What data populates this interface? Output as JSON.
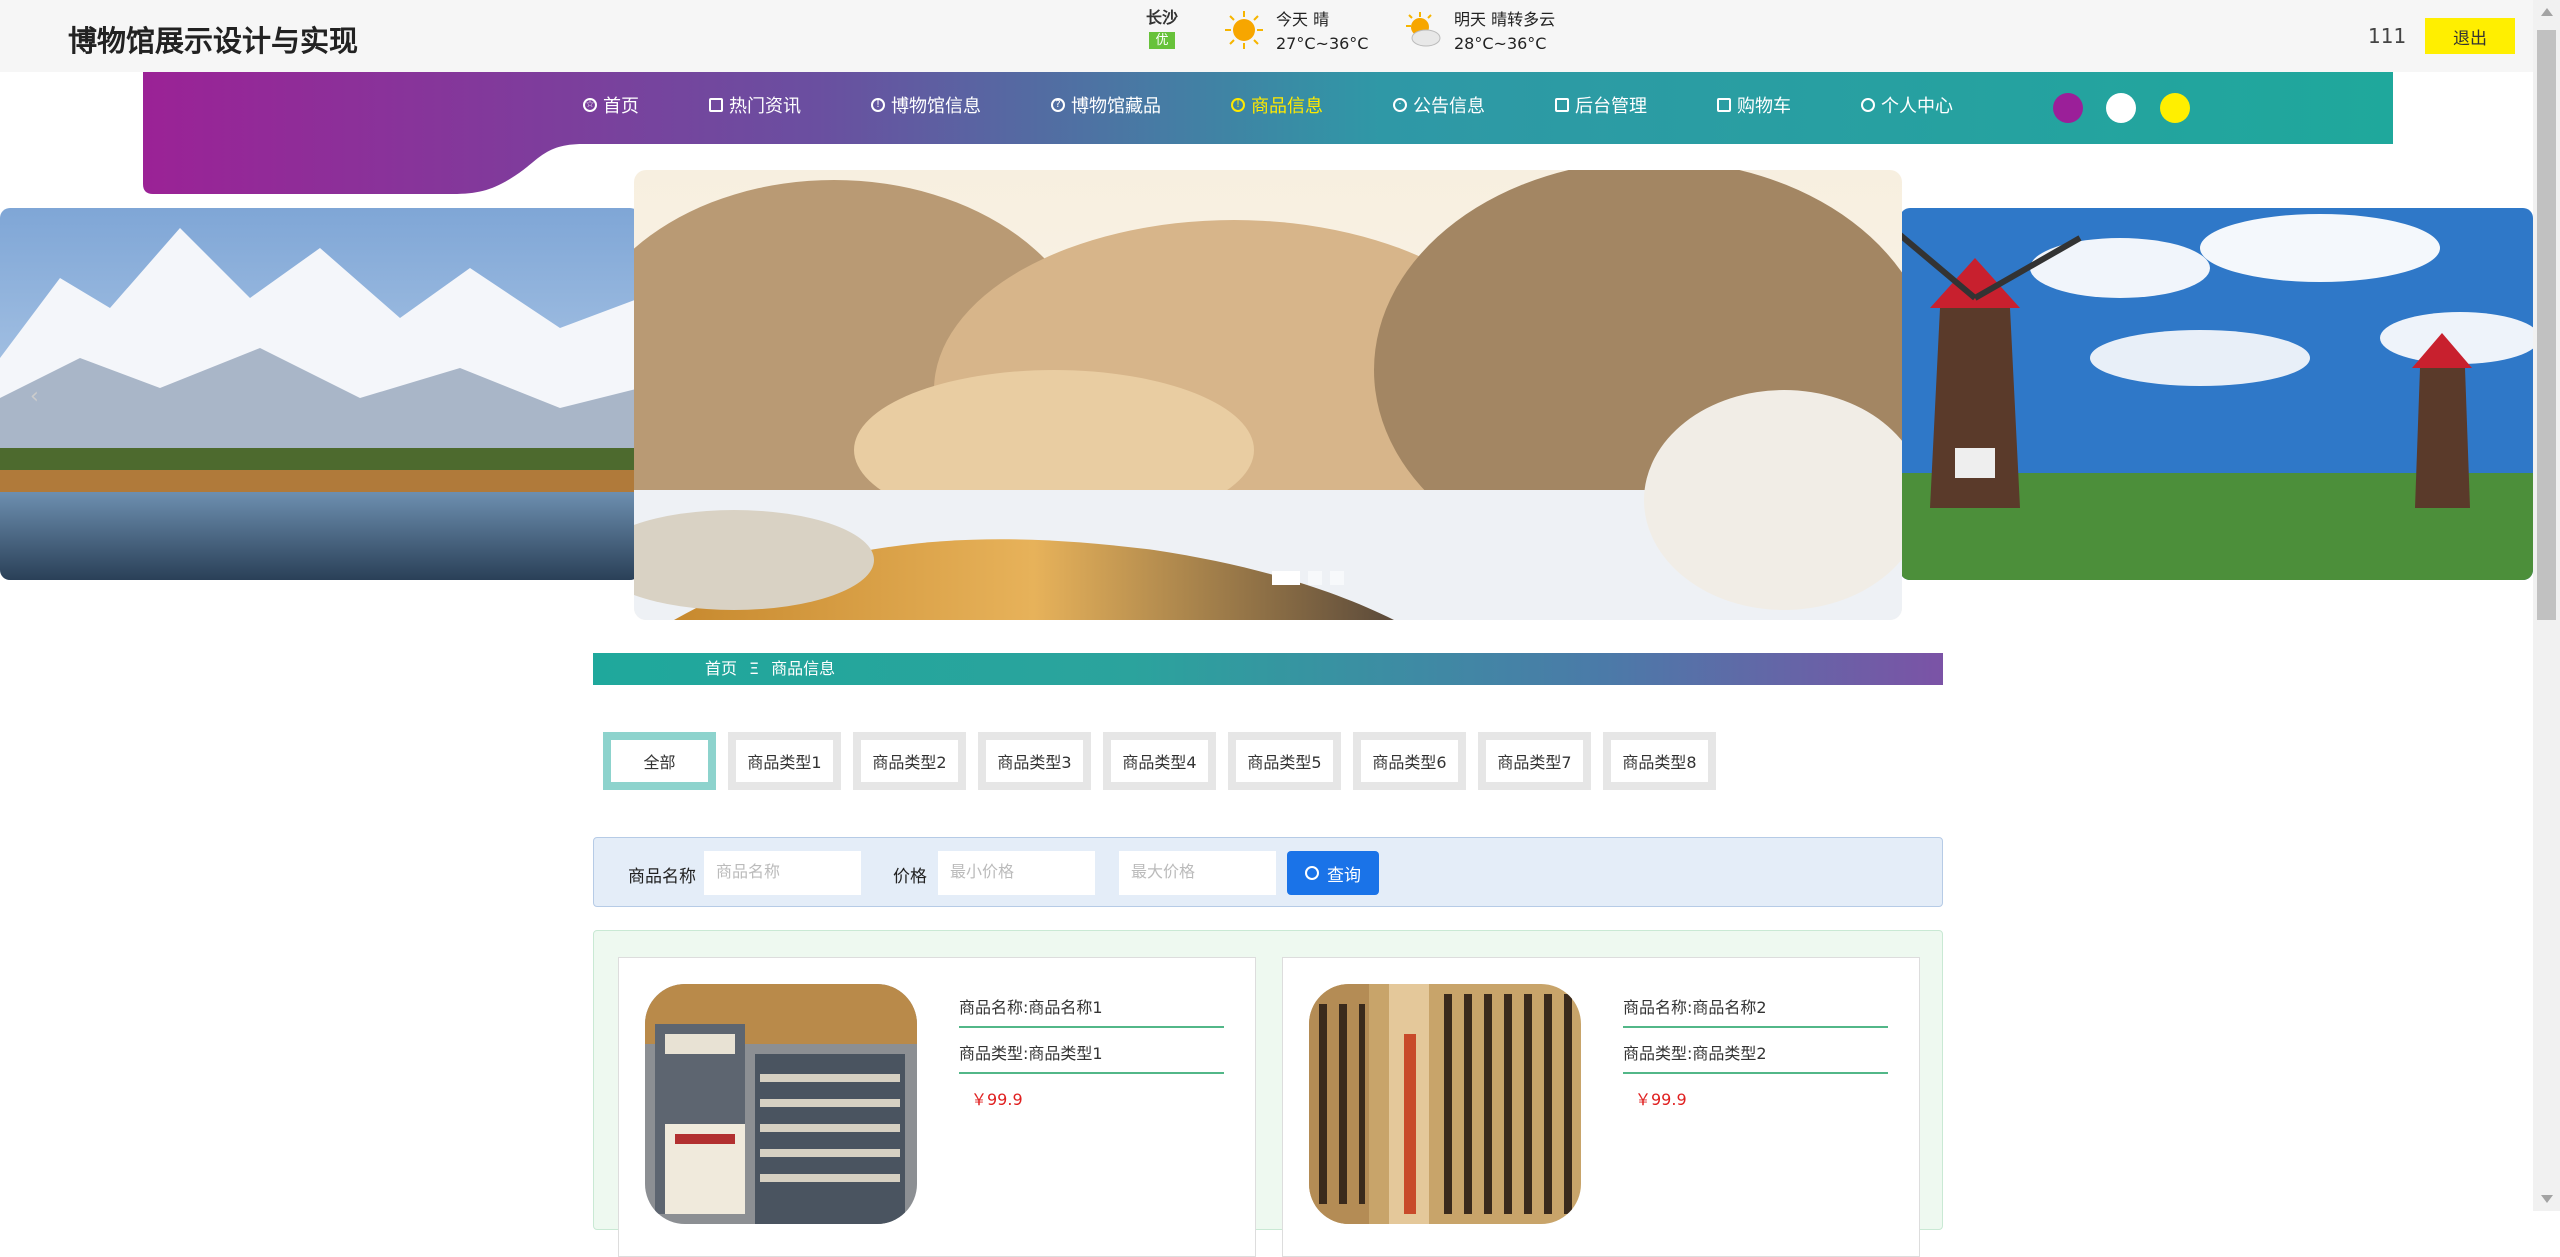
{
  "header": {
    "site_title": "博物馆展示设计与实现",
    "username": "111",
    "logout_label": "退出"
  },
  "weather": {
    "city": "长沙",
    "aqi": "优",
    "today_label": "今天",
    "today_condition": "晴",
    "today_temp": "27°C~36°C",
    "tomorrow_label": "明天",
    "tomorrow_condition": "晴转多云",
    "tomorrow_temp": "28°C~36°C"
  },
  "nav": {
    "items": [
      {
        "label": "首页",
        "icon": "star-icon"
      },
      {
        "label": "热门资讯",
        "icon": "bag-icon"
      },
      {
        "label": "博物馆信息",
        "icon": "info-icon"
      },
      {
        "label": "博物馆藏品",
        "icon": "question-icon"
      },
      {
        "label": "商品信息",
        "icon": "info-icon"
      },
      {
        "label": "公告信息",
        "icon": "gear-icon"
      },
      {
        "label": "后台管理",
        "icon": "gift-icon"
      },
      {
        "label": "购物车",
        "icon": "cart-icon"
      },
      {
        "label": "个人中心",
        "icon": "user-icon"
      }
    ],
    "active_index": 4,
    "theme_colors": [
      "#9b1f99",
      "#ffffff",
      "#ffef00"
    ]
  },
  "colors": {
    "nav_gradient_start": "#9b2296",
    "nav_gradient_mid": "#3a8fa8",
    "nav_gradient_end": "#1fa89c",
    "active_nav": "#ffe900",
    "price": "#e02020",
    "query_button": "#1a73e8"
  },
  "breadcrumb": {
    "home": "首页",
    "separator": "Ξ",
    "current": "商品信息"
  },
  "categories": {
    "items": [
      "全部",
      "商品类型1",
      "商品类型2",
      "商品类型3",
      "商品类型4",
      "商品类型5",
      "商品类型6",
      "商品类型7",
      "商品类型8"
    ],
    "active_index": 0
  },
  "search": {
    "name_label": "商品名称",
    "name_placeholder": "商品名称",
    "price_label": "价格",
    "min_placeholder": "最小价格",
    "max_placeholder": "最大价格",
    "query_label": "查询"
  },
  "products": [
    {
      "name": "商品名称:商品名称1",
      "type": "商品类型:商品类型1",
      "price": "￥99.9"
    },
    {
      "name": "商品名称:商品名称2",
      "type": "商品类型:商品类型2",
      "price": "￥99.9"
    }
  ]
}
